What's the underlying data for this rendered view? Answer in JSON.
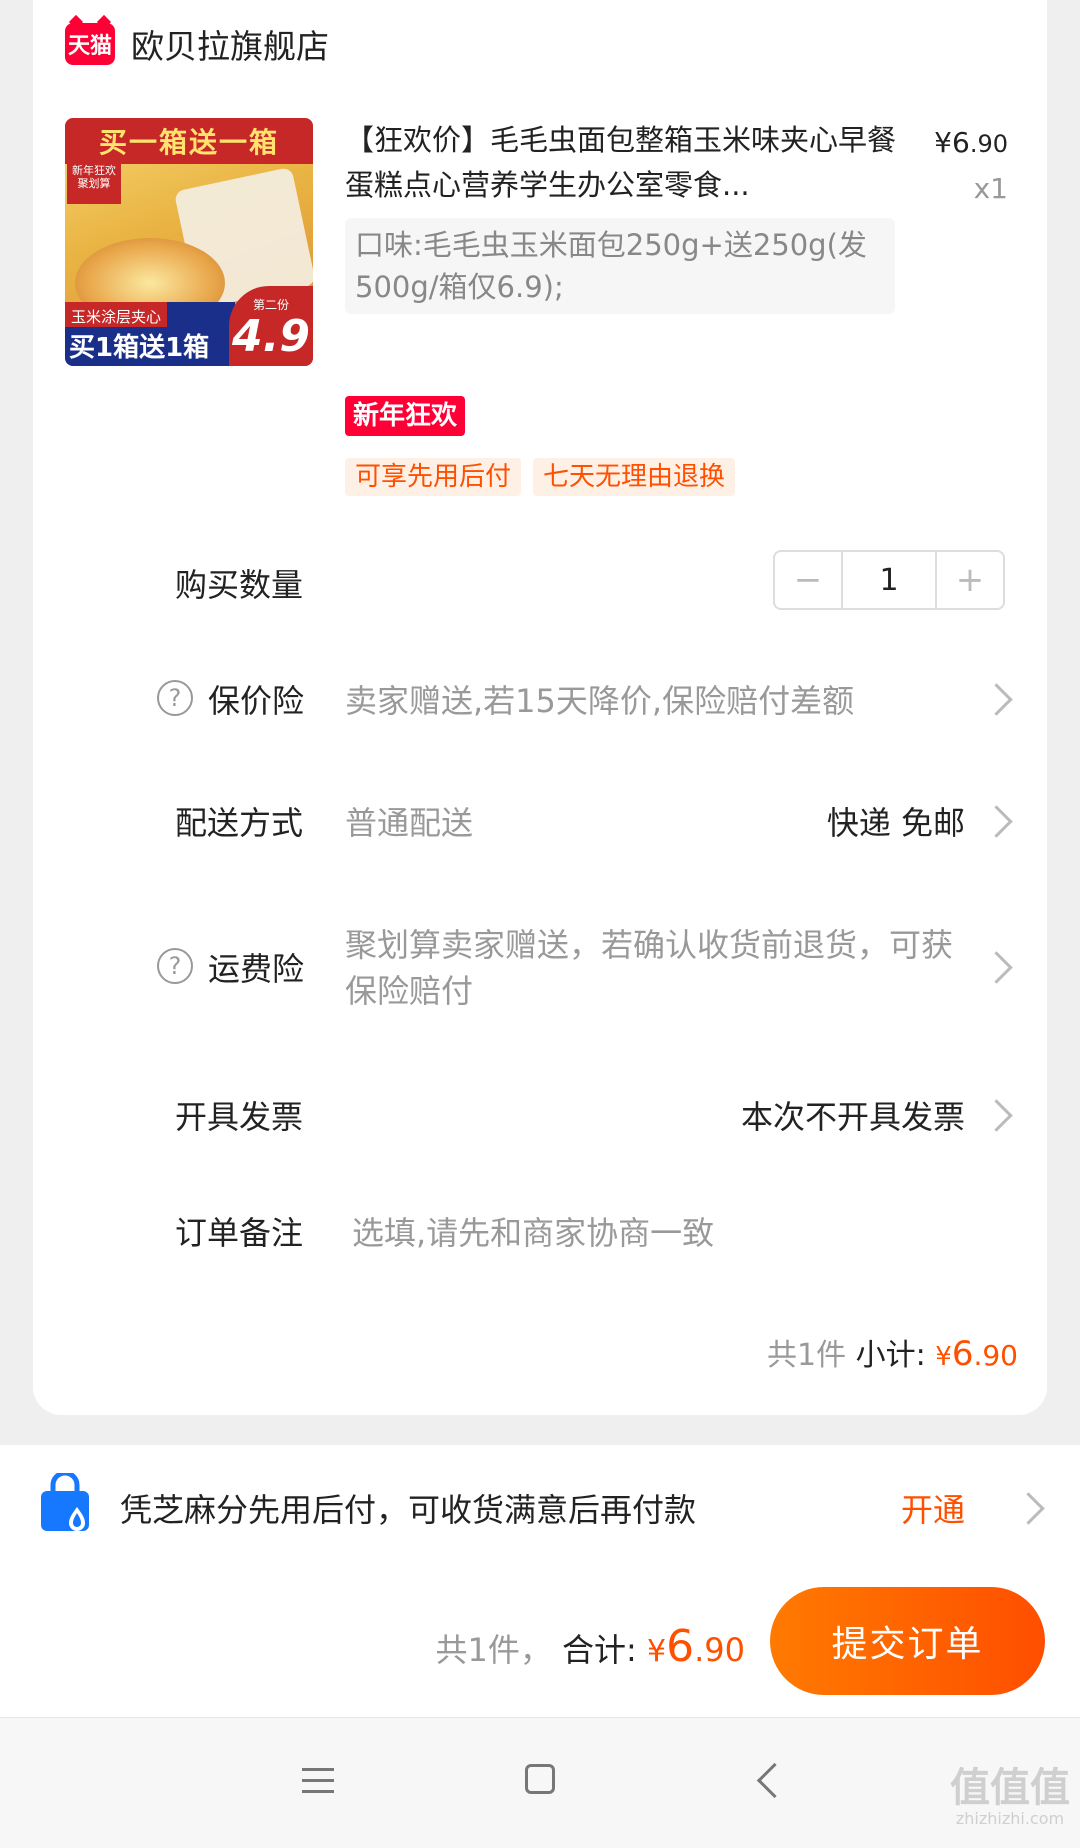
{
  "store": {
    "logo_text": "天猫",
    "name": "欧贝拉旗舰店"
  },
  "product": {
    "image": {
      "top_banner": "买一箱送一箱",
      "corner_badge": "新年狂欢 聚划算",
      "bottom_line1": "玉米涂层夹心",
      "bottom_line2": "买1箱送1箱",
      "price_label": "第二份",
      "price_value": "4.9"
    },
    "title": "【狂欢价】毛毛虫面包整箱玉米味夹心早餐蛋糕点心营养学生办公室零食...",
    "price_symbol": "¥",
    "price_int": "6",
    "price_cents": ".90",
    "quantity_label": "x1",
    "spec": "口味:毛毛虫玉米面包250g+送250g(发500g/箱仅6.9);",
    "promo_tag": "新年狂欢",
    "service_tags": [
      "可享先用后付",
      "七天无理由退换"
    ]
  },
  "rows": {
    "quantity": {
      "label": "购买数量",
      "minus": "−",
      "value": "1",
      "plus": "+"
    },
    "price_protect": {
      "icon": "?",
      "label": "保价险",
      "value": "卖家赠送,若15天降价,保险赔付差额"
    },
    "delivery": {
      "label": "配送方式",
      "value": "普通配送",
      "right": "快递 免邮"
    },
    "shipping_insurance": {
      "icon": "?",
      "label": "运费险",
      "value": "聚划算卖家赠送，若确认收货前退货，可获保险赔付"
    },
    "invoice": {
      "label": "开具发票",
      "right": "本次不开具发票"
    },
    "note": {
      "label": "订单备注",
      "placeholder": "选填,请先和商家协商一致"
    }
  },
  "subtotal": {
    "count": "共1件",
    "label": "小计:",
    "price_symbol": "¥",
    "price_int": "6",
    "price_cents": ".90"
  },
  "credit": {
    "text": "凭芝麻分先用后付，可收货满意后再付款",
    "action": "开通"
  },
  "checkout": {
    "count": "共1件，",
    "label": "合计:",
    "price_symbol": "¥",
    "price_int": "6",
    "price_cents": ".90",
    "submit": "提交订单"
  },
  "watermark": {
    "main": "值值值",
    "sub": "zhizhizhi.com"
  },
  "colors": {
    "accent": "#ff5000",
    "tmall_red": "#ff0036",
    "muted": "#999999"
  }
}
